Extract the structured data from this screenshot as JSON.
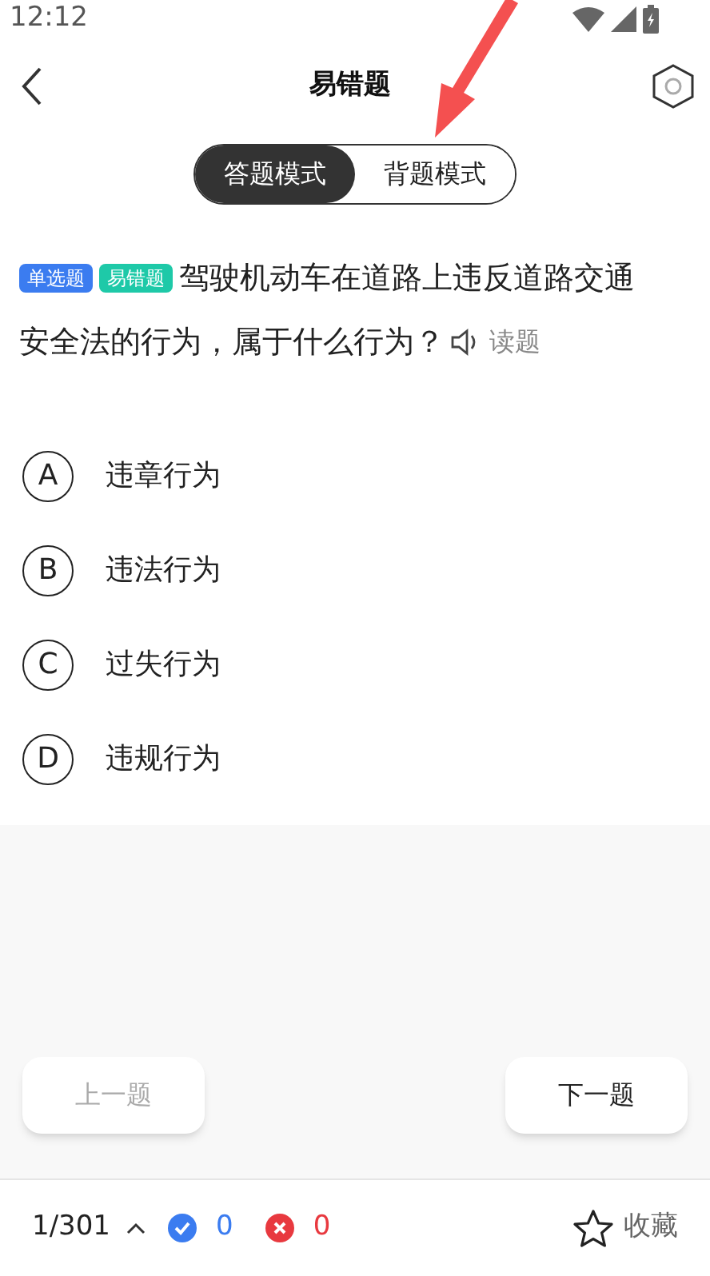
{
  "status_bar": {
    "time": "12:12"
  },
  "header": {
    "title": "易错题"
  },
  "mode_tabs": [
    {
      "label": "答题模式",
      "selected": true
    },
    {
      "label": "背题模式",
      "selected": false
    }
  ],
  "question": {
    "tags": [
      {
        "label": "单选题",
        "color": "#3b7cf0"
      },
      {
        "label": "易错题",
        "color": "#1ec9a8"
      }
    ],
    "text_lines": [
      "驾驶机动车在道路上违反道路交通",
      "安全法的行为，属于什么行为？"
    ],
    "read_label": "读题"
  },
  "options": [
    {
      "letter": "A",
      "text": "违章行为",
      "selected": false
    },
    {
      "letter": "B",
      "text": "违法行为",
      "selected": false
    },
    {
      "letter": "C",
      "text": "过失行为",
      "selected": false
    },
    {
      "letter": "D",
      "text": "违规行为",
      "selected": false
    }
  ],
  "nav": [
    {
      "label": "上一题",
      "disabled": true
    },
    {
      "label": "下一题",
      "disabled": false
    }
  ],
  "footer": {
    "progress": "1/301",
    "correct": "0",
    "wrong": "0",
    "favorite": "收藏"
  }
}
